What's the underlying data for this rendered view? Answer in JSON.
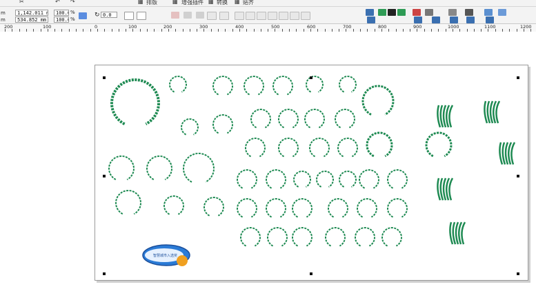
{
  "toolbar_top": {
    "items": [
      "排版",
      "增强插件",
      "转换",
      "贴齐"
    ]
  },
  "property_bar": {
    "width_value": "1,142.011 mm",
    "height_value": "534.852 mm",
    "scale_x": "100.0",
    "scale_y": "100.0",
    "scale_unit": "%",
    "rotation": "0.0",
    "width_label": "m",
    "height_label": "m"
  },
  "ruler": {
    "ticks": [
      "200",
      "100",
      "0",
      "100",
      "200",
      "300",
      "400",
      "500",
      "600",
      "700",
      "800",
      "900",
      "1000",
      "1100",
      "1200"
    ]
  },
  "colors": {
    "wreath_green": "#1e8a52",
    "ui_gray": "#f3f3f3",
    "badge_blue": "#2b7bd6",
    "thumb_orange": "#f0a020"
  },
  "document": {
    "badge_text": "智慧城市入选奖"
  }
}
